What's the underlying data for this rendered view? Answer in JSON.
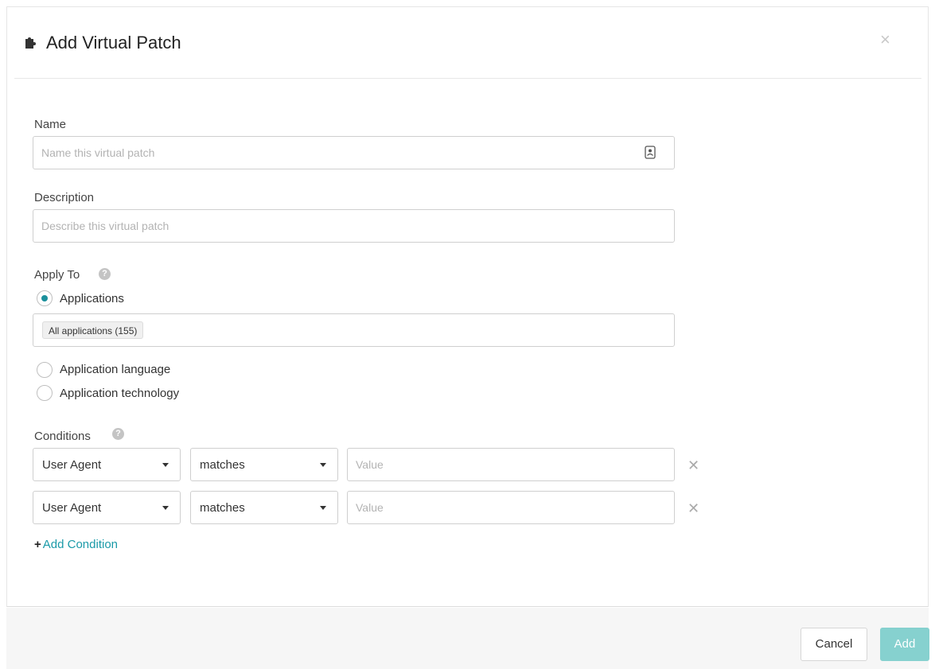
{
  "dialog": {
    "title": "Add Virtual Patch",
    "close_label": "×",
    "icon": "puzzle-piece-icon"
  },
  "form": {
    "name_label": "Name",
    "name_placeholder": "Name this virtual patch",
    "description_label": "Description",
    "description_placeholder": "Describe this virtual patch",
    "apply_to_label": "Apply To",
    "help_glyph": "?",
    "apply_options": [
      {
        "label": "Applications",
        "checked": true
      },
      {
        "label": "Application language",
        "checked": false
      },
      {
        "label": "Application technology",
        "checked": false
      }
    ],
    "applications_tag": "All applications (155)",
    "conditions_label": "Conditions",
    "conditions": [
      {
        "field": "User Agent",
        "operator": "matches",
        "value_placeholder": "Value"
      },
      {
        "field": "User Agent",
        "operator": "matches",
        "value_placeholder": "Value"
      }
    ],
    "remove_glyph": "✕",
    "add_condition_plus": "+",
    "add_condition_label": "Add Condition"
  },
  "footer": {
    "cancel_label": "Cancel",
    "add_label": "Add"
  },
  "colors": {
    "accent": "#1a8f9b",
    "link": "#1a9aa8",
    "add_button_disabled": "#86d1cf"
  }
}
